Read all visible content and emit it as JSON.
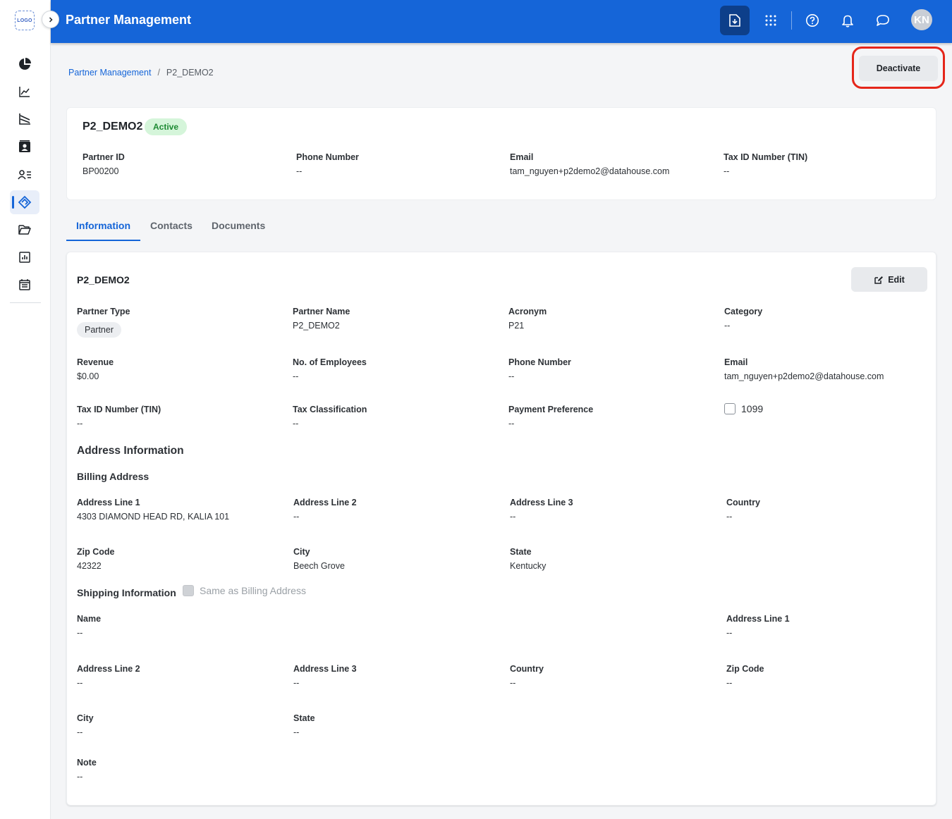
{
  "sidebar": {
    "logo_text": "LOGO",
    "items": [
      {
        "icon": "pie-chart-icon"
      },
      {
        "icon": "trend-line-icon"
      },
      {
        "icon": "analytics-icon"
      },
      {
        "icon": "contact-card-icon"
      },
      {
        "icon": "user-list-icon"
      },
      {
        "icon": "partner-handshake-icon",
        "active": true
      },
      {
        "icon": "folder-open-icon"
      },
      {
        "icon": "report-chart-icon"
      },
      {
        "icon": "calendar-list-icon"
      }
    ]
  },
  "header": {
    "title": "Partner Management",
    "avatar_initials": "KN",
    "icons": [
      "download-icon",
      "apps-grid-icon",
      "help-icon",
      "bell-icon",
      "chat-icon"
    ]
  },
  "breadcrumb": {
    "parent": "Partner Management",
    "current": "P2_DEMO2"
  },
  "actions": {
    "deactivate_label": "Deactivate"
  },
  "summary": {
    "name": "P2_DEMO2",
    "status": "Active",
    "fields": [
      {
        "label": "Partner ID",
        "value": "BP00200"
      },
      {
        "label": "Phone Number",
        "value": "--"
      },
      {
        "label": "Email",
        "value": "tam_nguyen+p2demo2@datahouse.com"
      },
      {
        "label": "Tax ID Number (TIN)",
        "value": "--"
      }
    ]
  },
  "tabs": [
    {
      "label": "Information",
      "active": true
    },
    {
      "label": "Contacts"
    },
    {
      "label": "Documents"
    }
  ],
  "info": {
    "title": "P2_DEMO2",
    "edit_label": "Edit",
    "partner_type_label": "Partner Type",
    "partner_type_value": "Partner",
    "partner_name_label": "Partner Name",
    "partner_name_value": "P2_DEMO2",
    "acronym_label": "Acronym",
    "acronym_value": "P21",
    "category_label": "Category",
    "category_value": "--",
    "revenue_label": "Revenue",
    "revenue_value": "$0.00",
    "employees_label": "No. of Employees",
    "employees_value": "--",
    "phone_label": "Phone Number",
    "phone_value": "--",
    "email_label": "Email",
    "email_value": "tam_nguyen+p2demo2@datahouse.com",
    "tin_label": "Tax ID Number (TIN)",
    "tin_value": "--",
    "tax_class_label": "Tax Classification",
    "tax_class_value": "--",
    "payment_label": "Payment Preference",
    "payment_value": "--",
    "form1099_label": "1099",
    "form1099_checked": false
  },
  "address": {
    "section_title": "Address Information",
    "billing_title": "Billing Address",
    "billing": {
      "line1_label": "Address Line 1",
      "line1_value": "4303 DIAMOND HEAD RD, KALIA 101",
      "line2_label": "Address Line 2",
      "line2_value": "--",
      "line3_label": "Address Line 3",
      "line3_value": "--",
      "country_label": "Country",
      "country_value": "--",
      "zip_label": "Zip Code",
      "zip_value": "42322",
      "city_label": "City",
      "city_value": "Beech Grove",
      "state_label": "State",
      "state_value": "Kentucky"
    },
    "shipping_title": "Shipping Information",
    "same_as_billing_label": "Same as Billing Address",
    "shipping": {
      "name_label": "Name",
      "name_value": "--",
      "line1_label": "Address Line 1",
      "line1_value": "--",
      "line2_label": "Address Line 2",
      "line2_value": "--",
      "line3_label": "Address Line 3",
      "line3_value": "--",
      "country_label": "Country",
      "country_value": "--",
      "zip_label": "Zip Code",
      "zip_value": "--",
      "city_label": "City",
      "city_value": "--",
      "state_label": "State",
      "state_value": "--",
      "note_label": "Note",
      "note_value": "--"
    }
  }
}
